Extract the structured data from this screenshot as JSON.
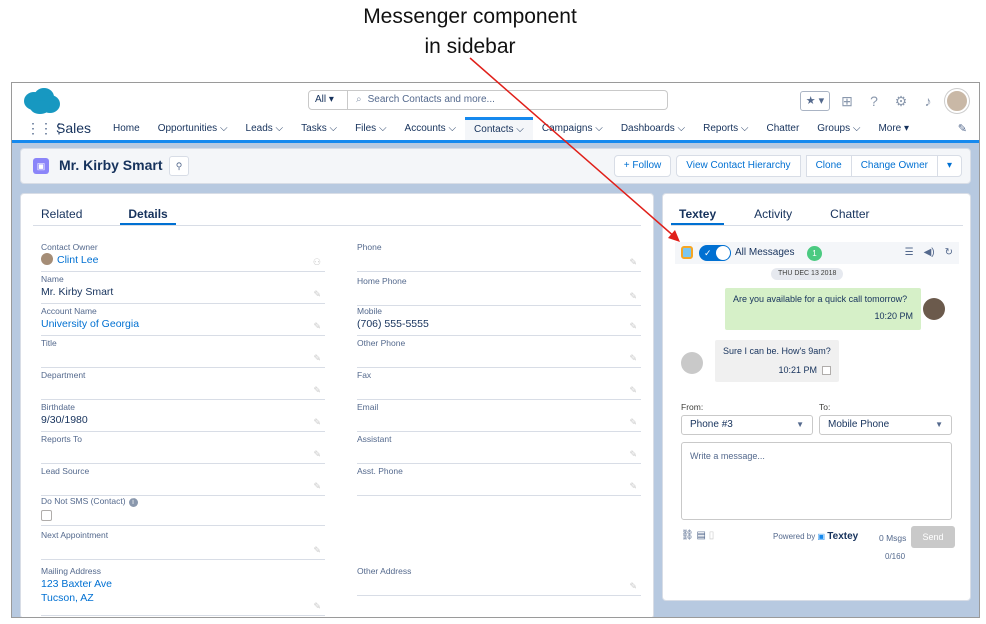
{
  "annotation": {
    "line1": "Messenger component",
    "line2": "in sidebar"
  },
  "header": {
    "search_scope": "All",
    "search_placeholder": "Search Contacts and more..."
  },
  "nav": {
    "app_name": "Sales",
    "items": [
      {
        "label": "Home",
        "active": false
      },
      {
        "label": "Opportunities ⌵",
        "active": false
      },
      {
        "label": "Leads ⌵",
        "active": false
      },
      {
        "label": "Tasks ⌵",
        "active": false
      },
      {
        "label": "Files ⌵",
        "active": false
      },
      {
        "label": "Accounts ⌵",
        "active": false
      },
      {
        "label": "Contacts ⌵",
        "active": true
      },
      {
        "label": "Campaigns ⌵",
        "active": false
      },
      {
        "label": "Dashboards ⌵",
        "active": false
      },
      {
        "label": "Reports ⌵",
        "active": false
      },
      {
        "label": "Chatter",
        "active": false
      },
      {
        "label": "Groups ⌵",
        "active": false
      },
      {
        "label": "More ▾",
        "active": false
      }
    ]
  },
  "record": {
    "title": "Mr. Kirby Smart",
    "follow": "+ Follow",
    "view_hierarchy": "View Contact Hierarchy",
    "clone": "Clone",
    "change_owner": "Change Owner"
  },
  "details": {
    "tab_related": "Related",
    "tab_details": "Details",
    "left": [
      {
        "label": "Contact Owner",
        "value": "Clint Lee"
      },
      {
        "label": "Name",
        "value": "Mr. Kirby Smart"
      },
      {
        "label": "Account Name",
        "value": "University of Georgia"
      },
      {
        "label": "Title",
        "value": ""
      },
      {
        "label": "Department",
        "value": ""
      },
      {
        "label": "Birthdate",
        "value": "9/30/1980"
      },
      {
        "label": "Reports To",
        "value": ""
      },
      {
        "label": "Lead Source",
        "value": ""
      },
      {
        "label": "Do Not SMS (Contact)",
        "value": ""
      },
      {
        "label": "Next Appointment",
        "value": ""
      },
      {
        "label": "Mailing Address",
        "value": "123 Baxter Ave",
        "value2": "Tucson, AZ"
      }
    ],
    "right": [
      {
        "label": "Phone",
        "value": ""
      },
      {
        "label": "Home Phone",
        "value": ""
      },
      {
        "label": "Mobile",
        "value": "(706) 555-5555"
      },
      {
        "label": "Other Phone",
        "value": ""
      },
      {
        "label": "Fax",
        "value": ""
      },
      {
        "label": "Email",
        "value": ""
      },
      {
        "label": "Assistant",
        "value": ""
      },
      {
        "label": "Asst. Phone",
        "value": ""
      },
      {
        "label": "Other Address",
        "value": ""
      }
    ]
  },
  "messenger": {
    "tabs": [
      "Textey",
      "Activity",
      "Chatter"
    ],
    "filter": "All Messages",
    "count": "1",
    "date": "THU DEC 13 2018",
    "outgoing": {
      "text": "Are you available for a quick call tomorrow?",
      "time": "10:20 PM"
    },
    "incoming": {
      "text": "Sure I can be. How's 9am?",
      "time": "10:21 PM"
    },
    "from_label": "From:",
    "to_label": "To:",
    "from_value": "Phone #3",
    "to_value": "Mobile Phone",
    "placeholder": "Write a message...",
    "powered_by": "Powered by",
    "brand": "Textey",
    "msgs": "0 Msgs",
    "send": "Send",
    "char_count": "0/160"
  }
}
